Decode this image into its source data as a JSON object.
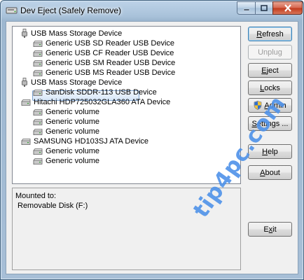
{
  "window": {
    "title": "Dev Eject (Safely Remove)"
  },
  "tree": {
    "items": [
      {
        "label": "USB Mass Storage Device",
        "kind": "usb",
        "level": 0
      },
      {
        "label": "Generic USB SD Reader USB Device",
        "kind": "drive",
        "level": 1
      },
      {
        "label": "Generic USB CF Reader USB Device",
        "kind": "drive",
        "level": 1
      },
      {
        "label": "Generic USB SM Reader USB Device",
        "kind": "drive",
        "level": 1
      },
      {
        "label": "Generic USB MS Reader USB Device",
        "kind": "drive",
        "level": 1
      },
      {
        "label": "USB Mass Storage Device",
        "kind": "usb",
        "level": 0
      },
      {
        "label": "SanDisk SDDR-113 USB Device",
        "kind": "drive",
        "level": 1,
        "selected": true
      },
      {
        "label": "Hitachi HDP725032GLA360 ATA Device",
        "kind": "drive",
        "level": 0
      },
      {
        "label": "Generic volume",
        "kind": "drive",
        "level": 1
      },
      {
        "label": "Generic volume",
        "kind": "drive",
        "level": 1
      },
      {
        "label": "Generic volume",
        "kind": "drive",
        "level": 1
      },
      {
        "label": "SAMSUNG HD103SJ ATA Device",
        "kind": "drive",
        "level": 0
      },
      {
        "label": "Generic volume",
        "kind": "drive",
        "level": 1
      },
      {
        "label": "Generic volume",
        "kind": "drive",
        "level": 1
      }
    ]
  },
  "info": {
    "line1": "Mounted to:",
    "line2": "Removable Disk (F:)"
  },
  "buttons": {
    "refresh_accel": "R",
    "refresh_rest": "efresh",
    "unplug": "Unplug",
    "eject_accel": "E",
    "eject_rest": "ject",
    "locks_accel": "L",
    "locks_rest": "ocks",
    "admin_accel": "A",
    "admin_rest": "dmin",
    "settings_accel": "S",
    "settings_rest": "ettings ...",
    "help_accel": "H",
    "help_rest": "elp",
    "about_accel": "A",
    "about_rest": "bout",
    "exit_accel": "x",
    "exit_pre": "E",
    "exit_rest": "it"
  },
  "watermark": {
    "text": "tip4pc.com"
  },
  "colors": {
    "selection_border": "#7da2ce",
    "watermark": "#4f92e9",
    "close_red": "#c0391c"
  }
}
